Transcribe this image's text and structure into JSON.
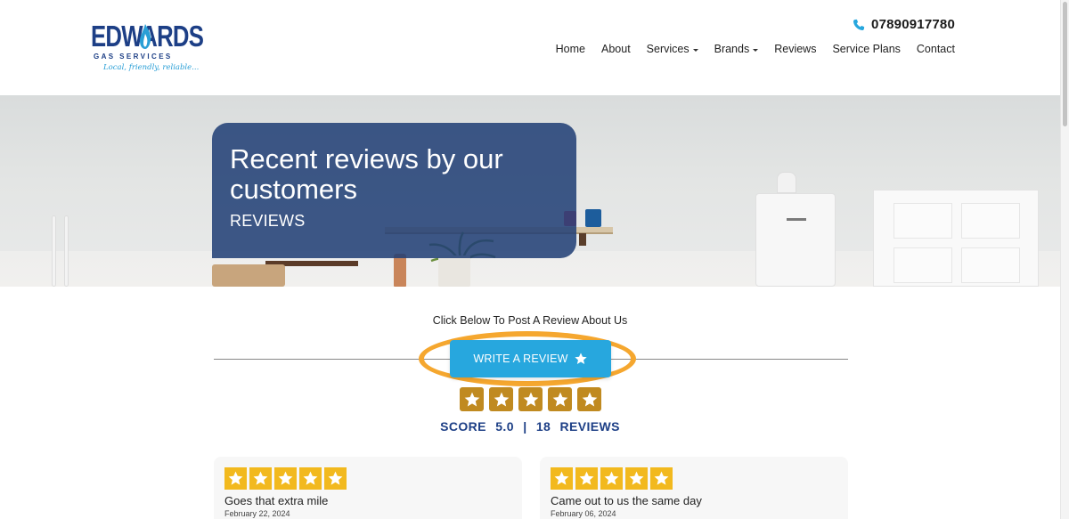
{
  "header": {
    "logo": {
      "word": "EDWARDS",
      "sub": "GAS SERVICES",
      "tagline": "Local, friendly, reliable..."
    },
    "phone": "07890917780",
    "nav": [
      {
        "label": "Home",
        "dropdown": false
      },
      {
        "label": "About",
        "dropdown": false
      },
      {
        "label": "Services",
        "dropdown": true
      },
      {
        "label": "Brands",
        "dropdown": true
      },
      {
        "label": "Reviews",
        "dropdown": false
      },
      {
        "label": "Service Plans",
        "dropdown": false
      },
      {
        "label": "Contact",
        "dropdown": false
      }
    ]
  },
  "hero": {
    "title_line1": "Recent reviews by our",
    "title_line2": "customers",
    "subtitle": "REVIEWS"
  },
  "review_cta": {
    "prompt": "Click Below To Post A Review About Us",
    "button_label": "WRITE A REVIEW",
    "score_label": "SCORE",
    "score_value": "5.0",
    "separator": "|",
    "review_count": "18",
    "reviews_label": "REVIEWS",
    "star_rating": 5
  },
  "reviews": [
    {
      "rating": 5,
      "title": "Goes that extra mile",
      "date": "February 22, 2024"
    },
    {
      "rating": 5,
      "title": "Came out to us the same day",
      "date": "February 06, 2024"
    }
  ],
  "colors": {
    "brand_navy": "#1d3f86",
    "accent_blue": "#27a7de",
    "highlight_orange": "#f5a72f",
    "star_gold": "#f2b91e",
    "star_box_dark": "#c08a20"
  },
  "icons": {
    "phone": "phone-icon",
    "button_star": "star-icon",
    "rating_star": "star-icon"
  }
}
